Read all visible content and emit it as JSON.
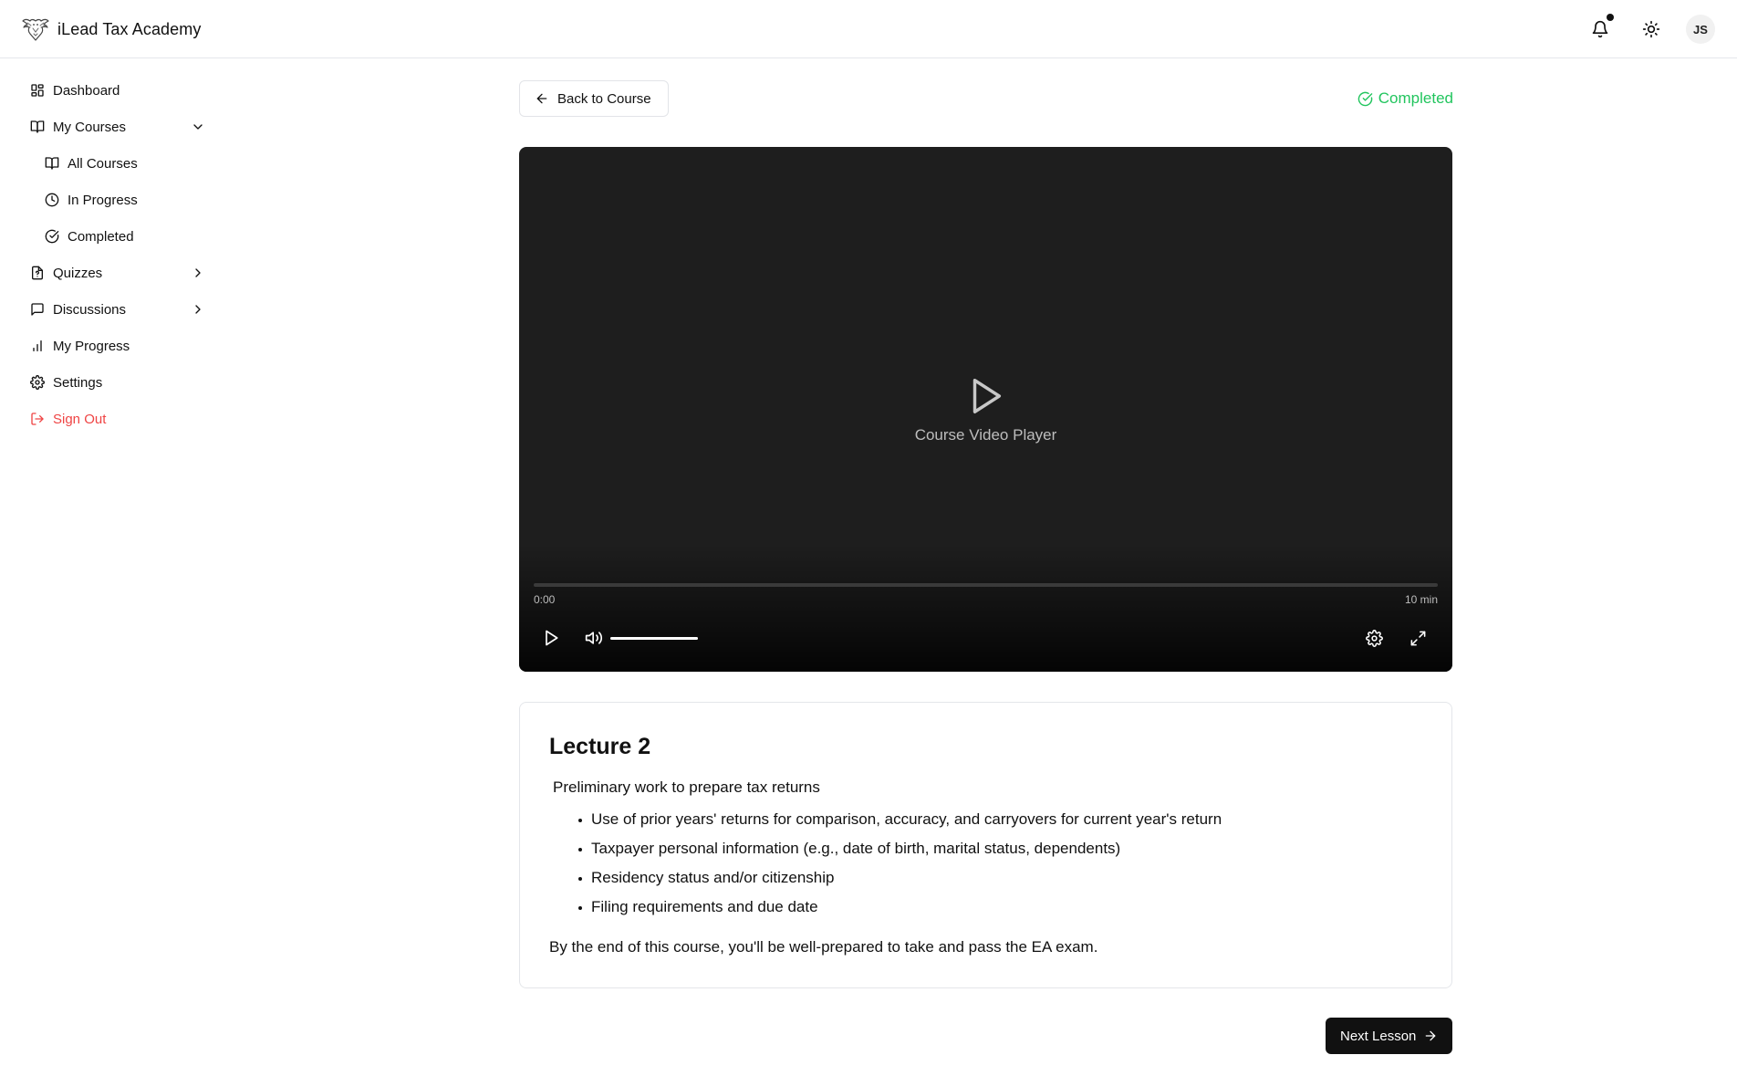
{
  "header": {
    "brand_name": "iLead Tax Academy",
    "logo_icon": "eagle-logo",
    "notification_dot": true,
    "avatar_initials": "JS"
  },
  "sidebar": {
    "items": [
      {
        "label": "Dashboard",
        "icon": "dashboard-icon"
      },
      {
        "label": "My Courses",
        "icon": "book-open-icon",
        "expanded": true
      },
      {
        "label": "All Courses",
        "icon": "book-open-icon",
        "sub": true
      },
      {
        "label": "In Progress",
        "icon": "clock-icon",
        "sub": true
      },
      {
        "label": "Completed",
        "icon": "check-circle-icon",
        "sub": true
      },
      {
        "label": "Quizzes",
        "icon": "file-question-icon",
        "expanded": false
      },
      {
        "label": "Discussions",
        "icon": "message-square-icon",
        "expanded": false
      },
      {
        "label": "My Progress",
        "icon": "bar-chart-icon"
      },
      {
        "label": "Settings",
        "icon": "gear-icon"
      },
      {
        "label": "Sign Out",
        "icon": "log-out-icon"
      }
    ]
  },
  "main": {
    "back_label": "Back to Course",
    "status_label": "Completed",
    "video": {
      "caption": "Course Video Player",
      "current_time": "0:00",
      "duration": "10 min",
      "progress": 0,
      "volume": 1
    },
    "lecture": {
      "title": "Lecture 2",
      "intro": "Preliminary work to prepare tax returns",
      "topics": [
        "Use of prior years' returns for comparison, accuracy, and carryovers for current year's return",
        "Taxpayer personal information (e.g., date of birth, marital status, dependents)",
        "Residency status and/or citizenship",
        "Filing requirements and due date"
      ],
      "outro": "By the end of this course, you'll be well-prepared to take and pass the EA exam."
    },
    "next_label": "Next Lesson"
  },
  "colors": {
    "accent_success": "#22c55e",
    "danger": "#ef4444",
    "primary_button": "#111111",
    "video_background": "#1e1e1e"
  }
}
